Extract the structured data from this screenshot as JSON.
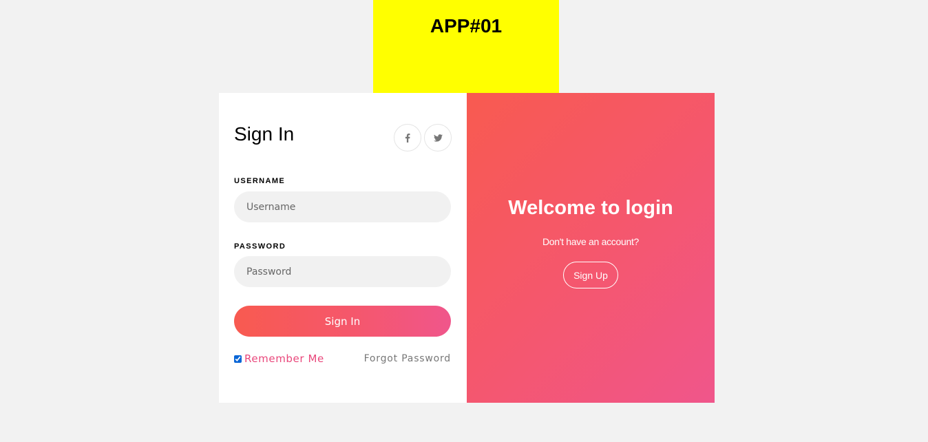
{
  "app_badge": {
    "title": "APP#01",
    "color": "#ffff00"
  },
  "signin": {
    "title": "Sign In",
    "social": [
      {
        "icon": "facebook-icon",
        "glyph": "f"
      },
      {
        "icon": "twitter-icon",
        "glyph": "🐦"
      }
    ],
    "username_label": "USERNAME",
    "username_placeholder": "Username",
    "password_label": "PASSWORD",
    "password_placeholder": "Password",
    "submit_label": "Sign In",
    "remember_label": "Remember Me",
    "remember_checked": true,
    "forgot_label": "Forgot Password"
  },
  "welcome": {
    "title": "Welcome to login",
    "subtitle": "Don't have an account?",
    "signup_label": "Sign Up"
  },
  "colors": {
    "accent_start": "#f85a50",
    "accent_end": "#f0568b",
    "remember_text": "#e9477b"
  }
}
